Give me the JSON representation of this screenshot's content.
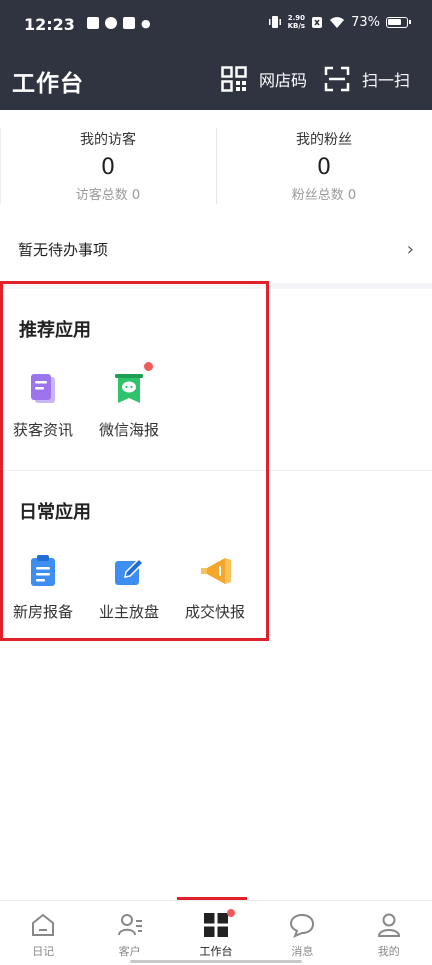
{
  "status_bar": {
    "time": "12:23",
    "speed": "2.90\nKB/s",
    "battery": "73%"
  },
  "header": {
    "title": "工作台",
    "shop_code_label": "网店码",
    "scan_label": "扫一扫"
  },
  "stats": {
    "visitors": {
      "title": "我的访客",
      "value": "0",
      "sub": "访客总数 0"
    },
    "fans": {
      "title": "我的粉丝",
      "value": "0",
      "sub": "粉丝总数 0"
    }
  },
  "todo": {
    "label": "暂无待办事项",
    "arrow": "›"
  },
  "recommended": {
    "title": "推荐应用",
    "apps": [
      {
        "label": "获客资讯",
        "icon": "document-purple-icon"
      },
      {
        "label": "微信海报",
        "icon": "wechat-poster-icon"
      }
    ]
  },
  "daily": {
    "title": "日常应用",
    "apps": [
      {
        "label": "新房报备",
        "icon": "clipboard-icon"
      },
      {
        "label": "业主放盘",
        "icon": "edit-icon"
      },
      {
        "label": "成交快报",
        "icon": "megaphone-icon"
      }
    ]
  },
  "tabbar": {
    "items": [
      {
        "label": "日记",
        "icon": "house-icon",
        "active": false
      },
      {
        "label": "客户",
        "icon": "contacts-icon",
        "active": false
      },
      {
        "label": "工作台",
        "icon": "grid-icon",
        "active": true
      },
      {
        "label": "消息",
        "icon": "chat-bubble-icon",
        "active": false
      },
      {
        "label": "我的",
        "icon": "person-icon",
        "active": false
      }
    ]
  },
  "colors": {
    "header_bg": "#2f3440",
    "highlight": "#e0212b",
    "notification_dot": "#ef5b5b"
  }
}
